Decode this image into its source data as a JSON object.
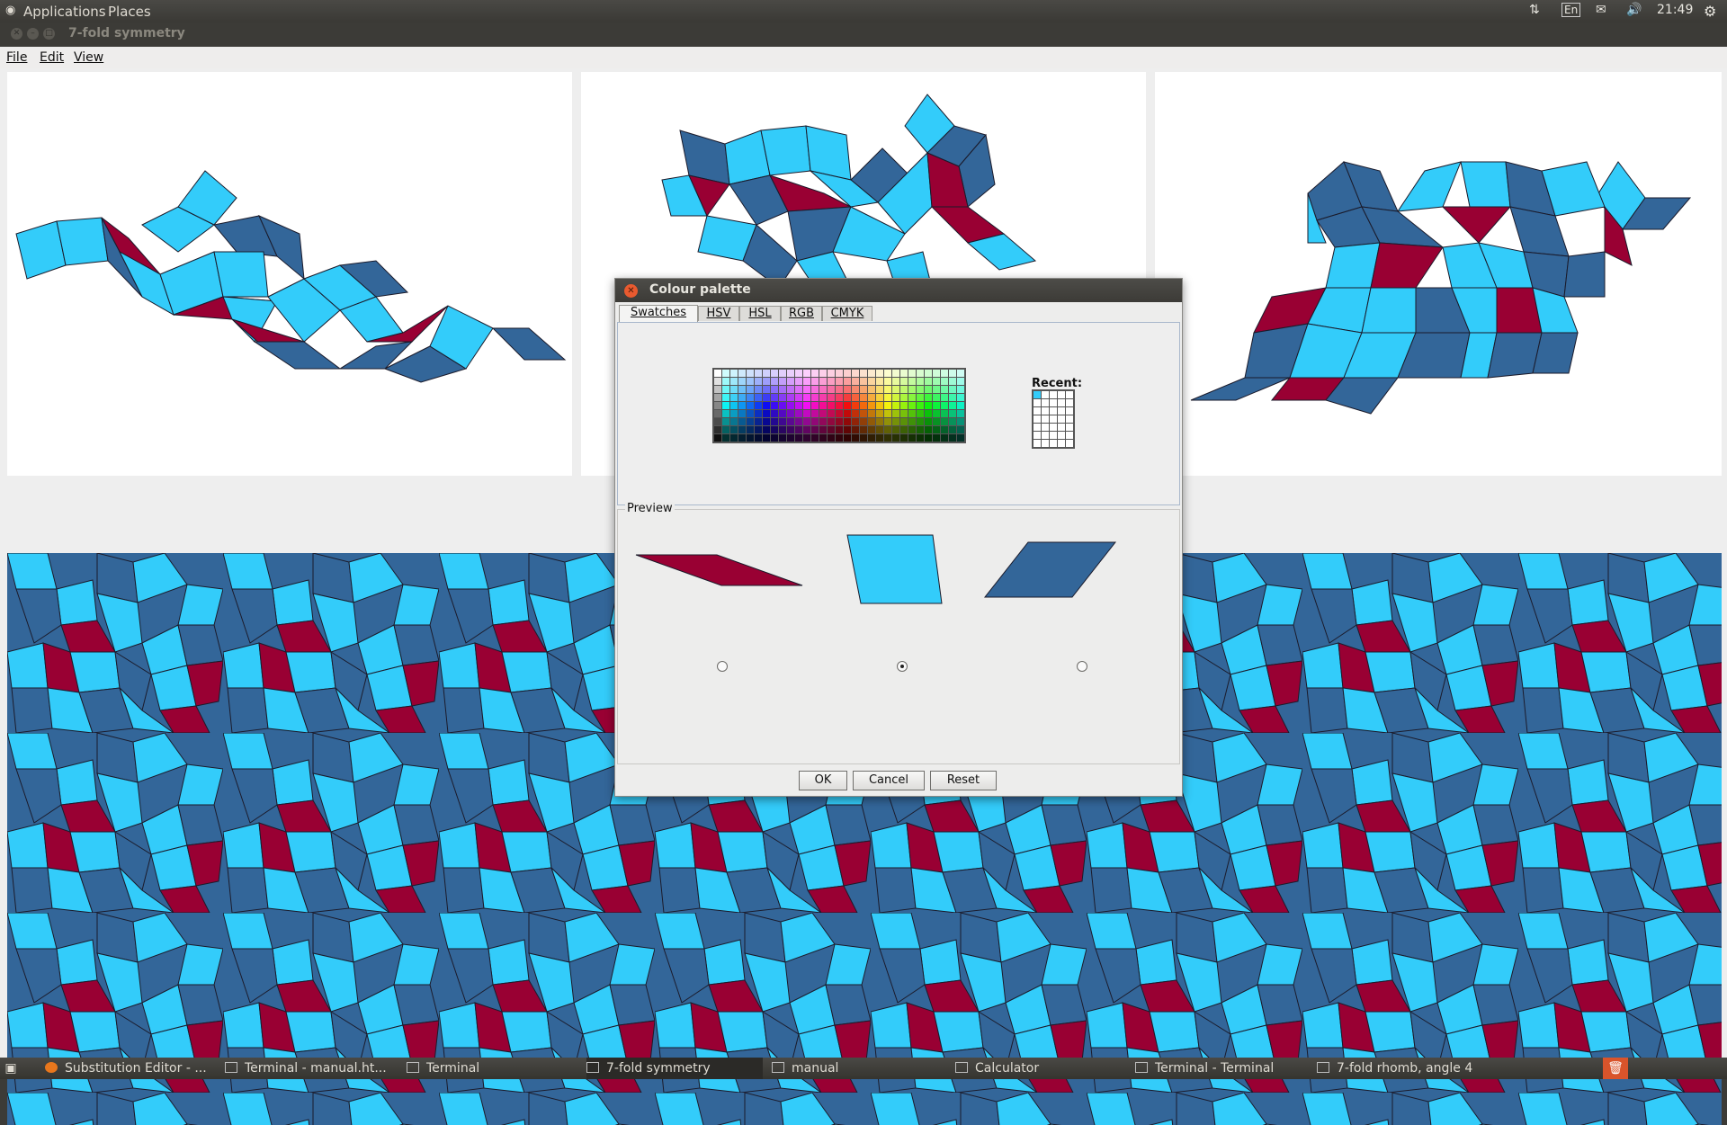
{
  "topbar": {
    "applications": "Applications",
    "places": "Places",
    "keyboard_layout": "En",
    "clock": "21:49"
  },
  "window": {
    "title": "7-fold symmetry"
  },
  "menubar": {
    "file": "File",
    "edit": "Edit",
    "view": "View"
  },
  "colors": {
    "light_blue": "#33ccfa",
    "dark_blue": "#336699",
    "crimson": "#990033"
  },
  "dialog": {
    "title": "Colour palette",
    "tabs": [
      "Swatches",
      "HSV",
      "HSL",
      "RGB",
      "CMYK"
    ],
    "active_tab": "Swatches",
    "recent_label": "Recent:",
    "preview_label": "Preview",
    "selected_preview_index": 1,
    "buttons": {
      "ok": "OK",
      "cancel": "Cancel",
      "reset": "Reset"
    }
  },
  "taskbar": {
    "items": [
      "Substitution Editor - ...",
      "Terminal - manual.ht...",
      "Terminal",
      "7-fold symmetry",
      "manual",
      "Calculator",
      "Terminal - Terminal",
      "7-fold rhomb, angle 4"
    ],
    "active_index": 3
  }
}
